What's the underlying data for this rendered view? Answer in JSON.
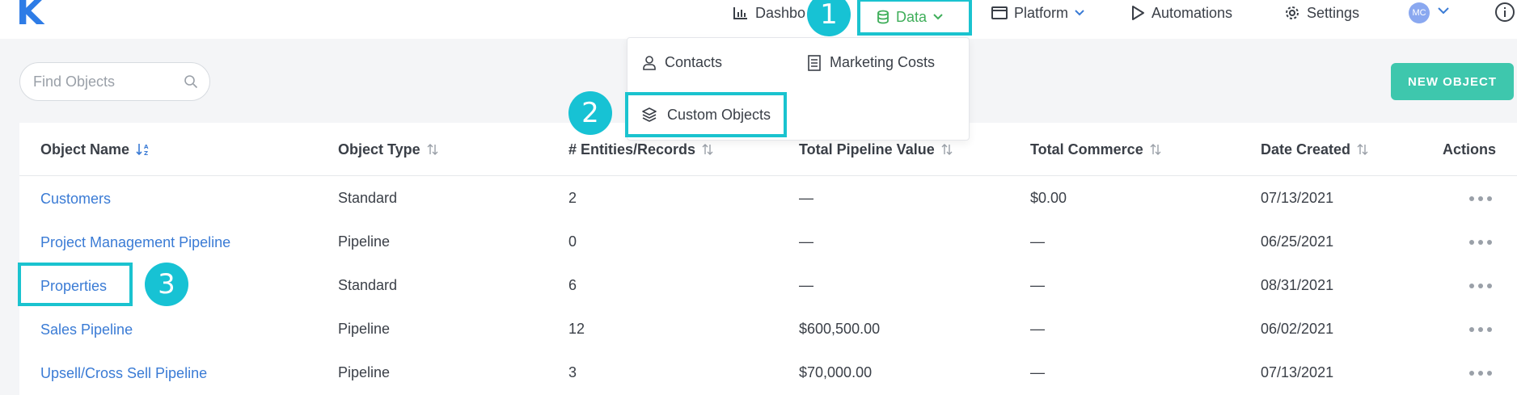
{
  "app": {
    "logo": "K"
  },
  "nav": {
    "dashboard": "Dashbo",
    "data": "Data",
    "platform": "Platform",
    "automations": "Automations",
    "settings": "Settings",
    "avatar_initials": "MC"
  },
  "steps": [
    "1",
    "2",
    "3"
  ],
  "dropdown": {
    "contacts": "Contacts",
    "marketing_costs": "Marketing Costs",
    "custom_objects": "Custom Objects"
  },
  "search": {
    "placeholder": "Find Objects",
    "value": ""
  },
  "new_object_label": "NEW OBJECT",
  "table": {
    "columns": [
      "Object Name",
      "Object Type",
      "# Entities/Records",
      "Total Pipeline Value",
      "Total Commerce",
      "Date Created",
      "Actions"
    ],
    "rows": [
      {
        "name": "Customers",
        "type": "Standard",
        "records": "2",
        "pipeline": "—",
        "commerce": "$0.00",
        "date": "07/13/2021"
      },
      {
        "name": "Project Management Pipeline",
        "type": "Pipeline",
        "records": "0",
        "pipeline": "—",
        "commerce": "—",
        "date": "06/25/2021"
      },
      {
        "name": "Properties",
        "type": "Standard",
        "records": "6",
        "pipeline": "—",
        "commerce": "—",
        "date": "08/31/2021"
      },
      {
        "name": "Sales Pipeline",
        "type": "Pipeline",
        "records": "12",
        "pipeline": "$600,500.00",
        "commerce": "—",
        "date": "06/02/2021"
      },
      {
        "name": "Upsell/Cross Sell Pipeline",
        "type": "Pipeline",
        "records": "3",
        "pipeline": "$70,000.00",
        "commerce": "—",
        "date": "07/13/2021"
      }
    ]
  },
  "colors": {
    "highlight": "#1ac3cf",
    "link": "#3a7bd5",
    "accent_button": "#3ec7ad",
    "active_nav": "#3fae5a"
  }
}
